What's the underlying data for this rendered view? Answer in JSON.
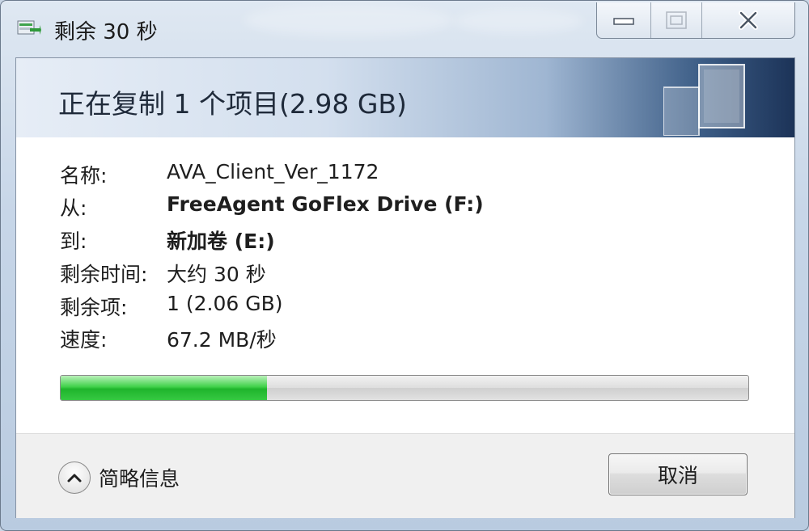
{
  "window": {
    "title": "剩余 30 秒"
  },
  "caption_buttons": {
    "minimize": "minimize-icon",
    "maximize": "maximize-icon",
    "close": "close-icon"
  },
  "header": {
    "title": "正在复制 1 个项目(2.98 GB)"
  },
  "details": {
    "rows": [
      {
        "label": "名称:",
        "value": "AVA_Client_Ver_1172",
        "bold": false
      },
      {
        "label": "从:",
        "value": "FreeAgent GoFlex Drive (F:)",
        "bold": true
      },
      {
        "label": "到:",
        "value": "新加卷 (E:)",
        "bold": true
      },
      {
        "label": "剩余时间:",
        "value": "大约 30 秒",
        "bold": false
      },
      {
        "label": "剩余项:",
        "value": "1 (2.06 GB)",
        "bold": false
      },
      {
        "label": "速度:",
        "value": "67.2 MB/秒",
        "bold": false
      }
    ]
  },
  "progress": {
    "fraction": 0.3,
    "color": "#2fc23a"
  },
  "footer": {
    "toggle_label": "简略信息",
    "cancel_label": "取消"
  }
}
